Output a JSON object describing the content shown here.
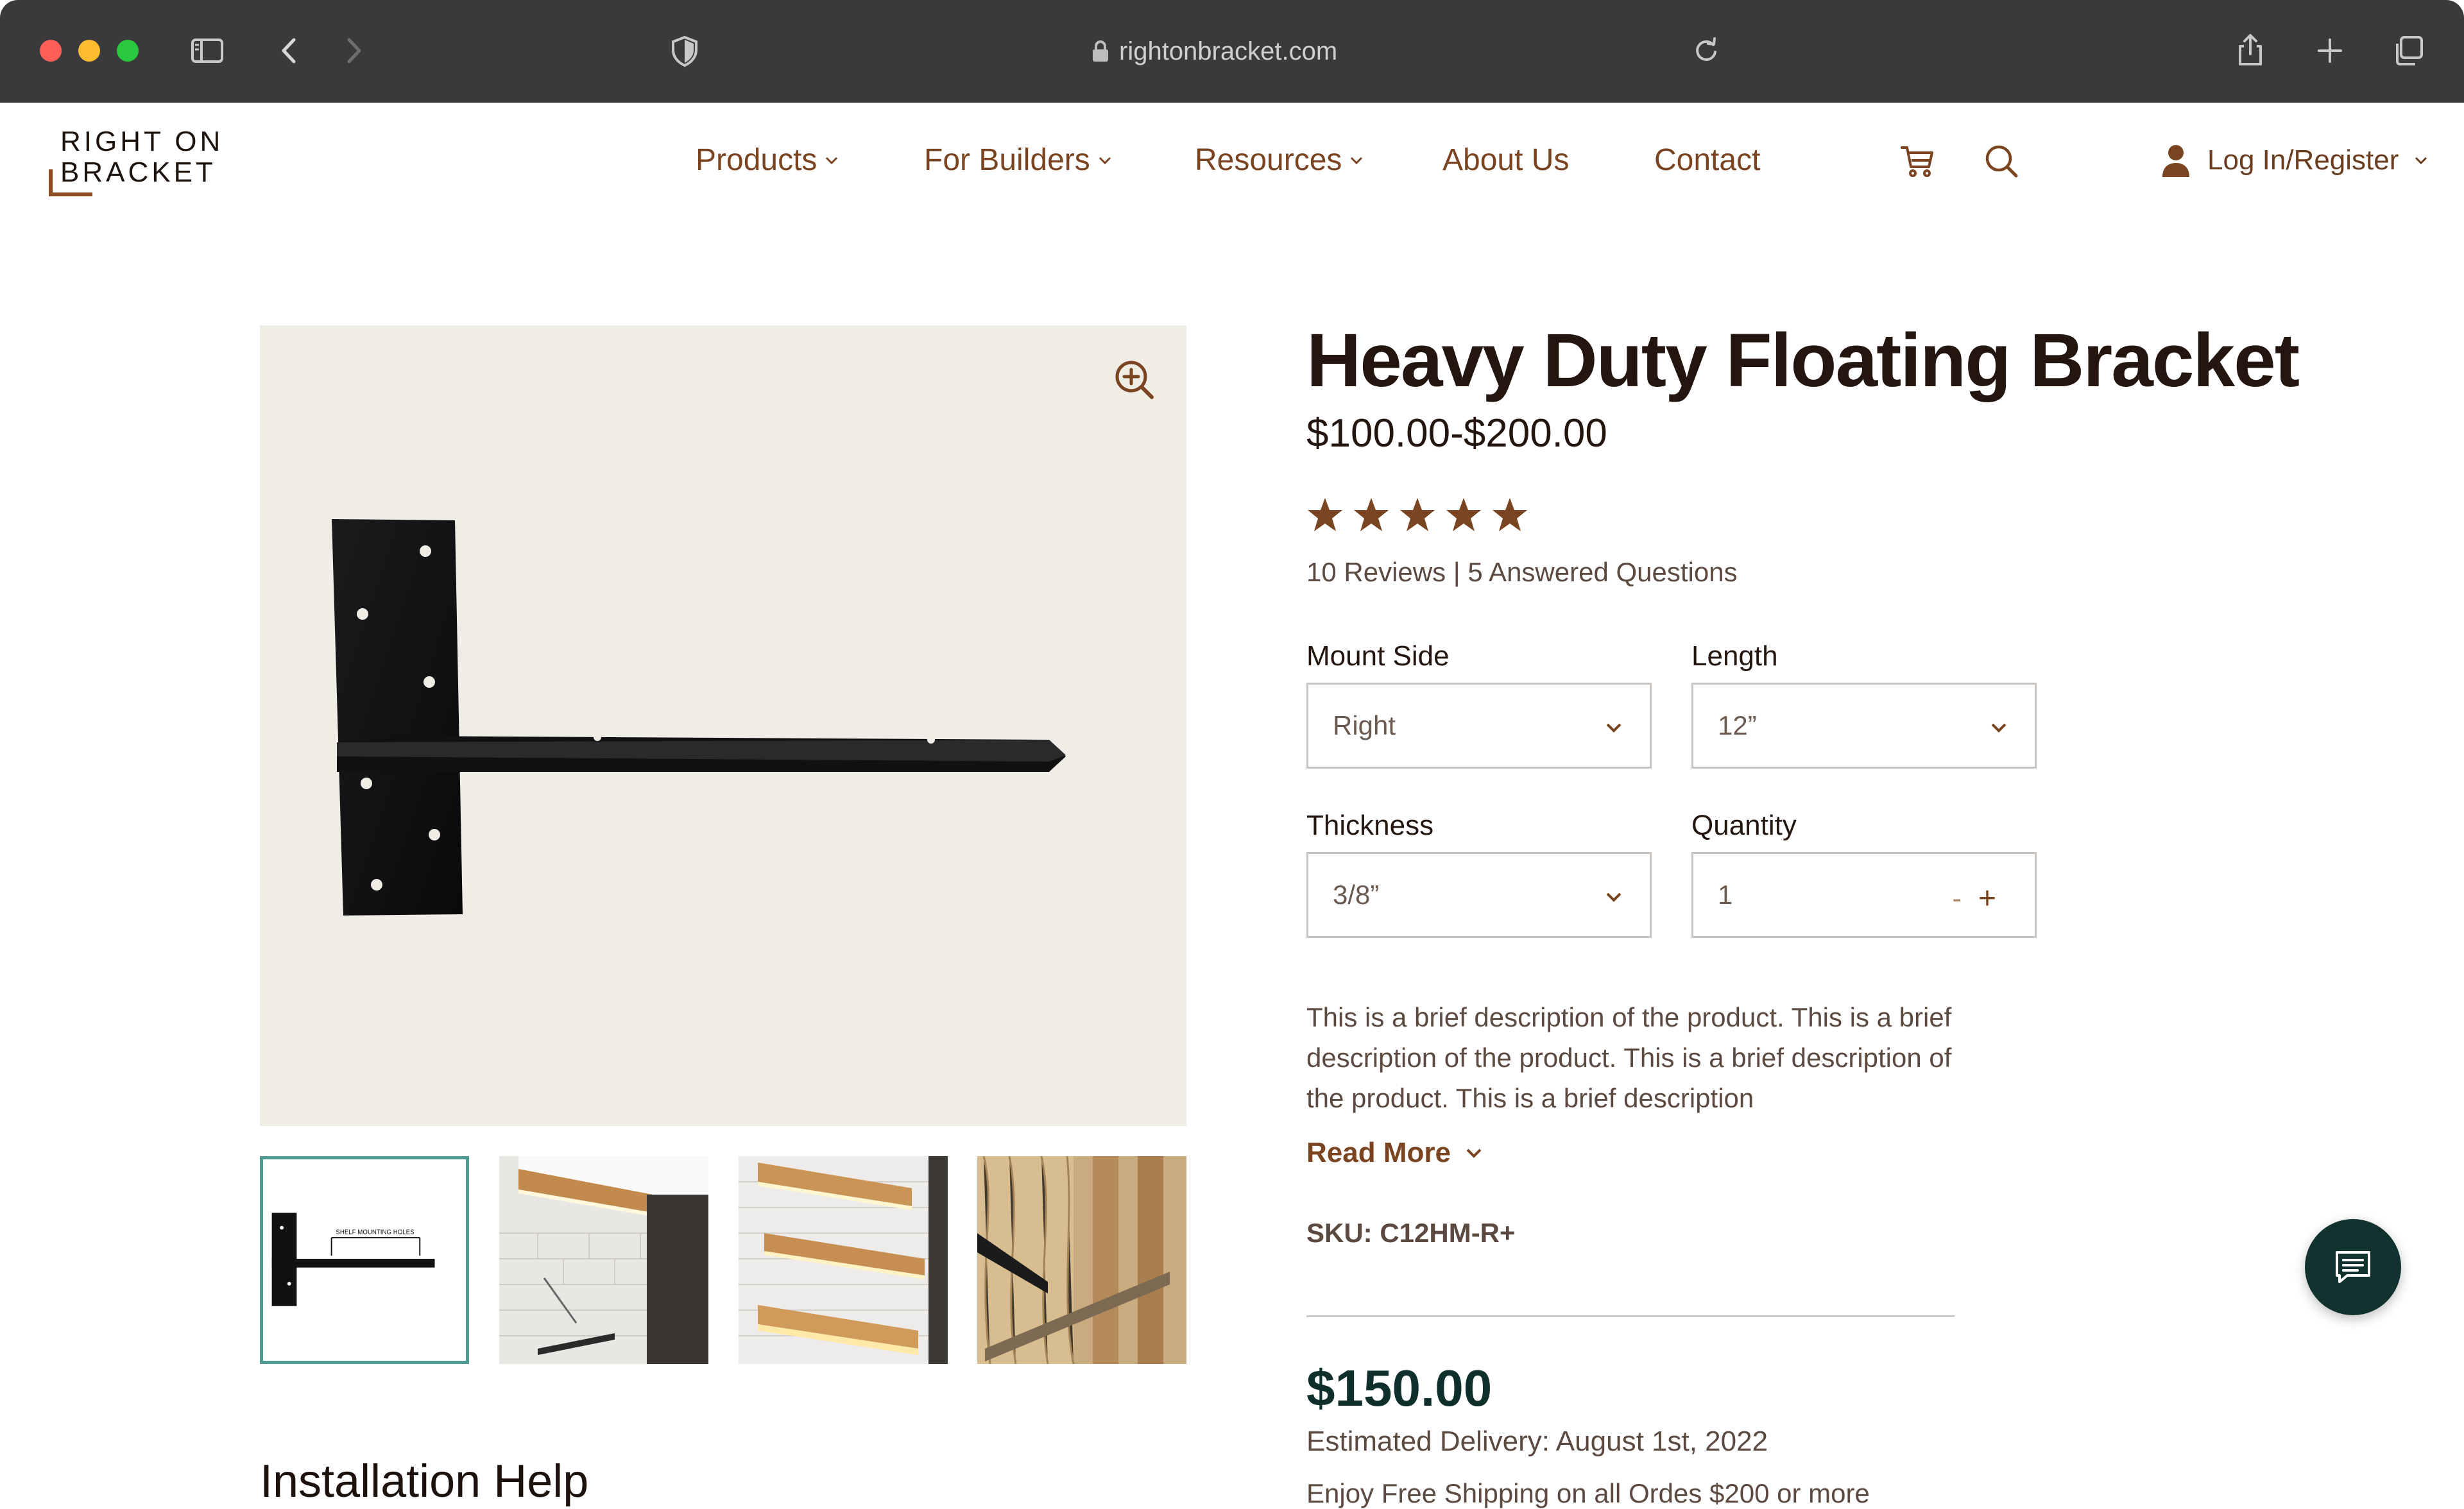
{
  "browser": {
    "url": "rightonbracket.com",
    "icons": [
      "sidebar-icon",
      "back-icon",
      "forward-icon",
      "shield-icon",
      "lock-icon",
      "reload-icon",
      "share-icon",
      "new-tab-icon",
      "tabs-overview-icon"
    ]
  },
  "site": {
    "logo_line1": "RIGHT ON",
    "logo_line2": "BRACKET",
    "nav": {
      "products": "Products",
      "for_builders": "For Builders",
      "resources": "Resources",
      "about": "About Us",
      "contact": "Contact"
    },
    "login": "Log In/Register",
    "colors": {
      "accent": "#7a4420",
      "dark_teal": "#123230",
      "thumb_border": "#4f9a92"
    }
  },
  "product": {
    "title": "Heavy Duty Floating Bracket",
    "price_range": "$100.00-$200.00",
    "rating": 5,
    "reviews_text": "10 Reviews | 5 Answered Questions",
    "options": {
      "mount_side": {
        "label": "Mount Side",
        "value": "Right"
      },
      "length": {
        "label": "Length",
        "value": "12”"
      },
      "thickness": {
        "label": "Thickness",
        "value": "3/8”"
      },
      "quantity": {
        "label": "Quantity",
        "value": "1",
        "minus": "-",
        "plus": "+"
      }
    },
    "description": "This is a brief description of the product. This is a brief description of the product. This is a brief description of the product. This is a brief description",
    "read_more": "Read More",
    "sku": "SKU: C12HM-R+",
    "price": "$150.00",
    "delivery": "Estimated Delivery: August 1st, 2022",
    "shipping": "Enjoy Free Shipping on all Ordes $200 or more"
  },
  "gallery": {
    "thumb1_caption": "SHELF MOUNTING HOLES",
    "selected_index": 0
  },
  "sections": {
    "installation_help": "Installation Help"
  }
}
